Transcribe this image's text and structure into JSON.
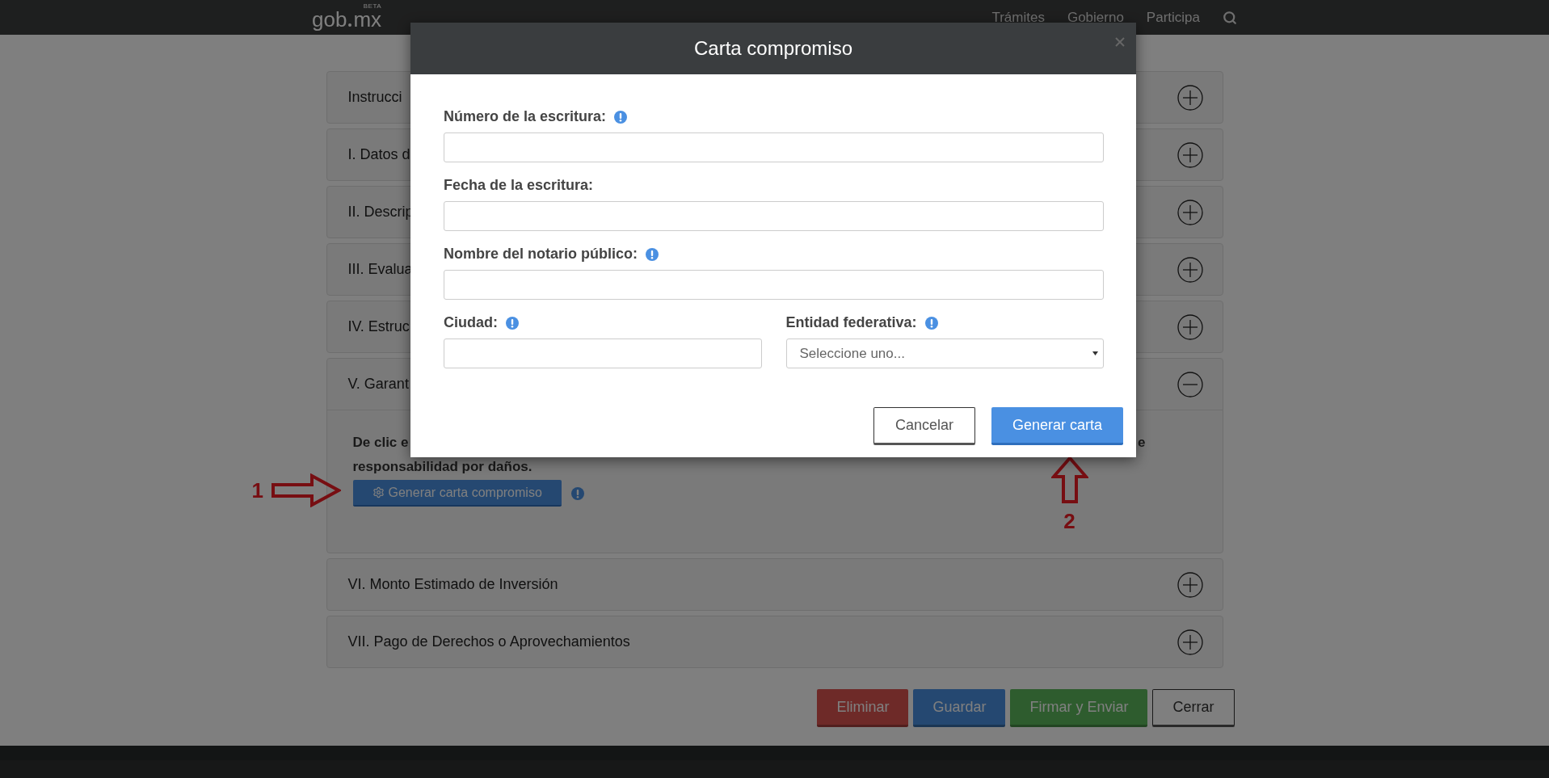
{
  "navbar": {
    "logo": {
      "text": "gob",
      "suffix": "mx",
      "badge": "BETA"
    },
    "links": [
      "Trámites",
      "Gobierno",
      "Participa"
    ]
  },
  "sections": [
    {
      "title": "Instrucci",
      "expanded": false
    },
    {
      "title": "I. Datos d",
      "expanded": false
    },
    {
      "title": "II. Descrip",
      "expanded": false
    },
    {
      "title": "III. Evalua",
      "expanded": false
    },
    {
      "title": "IV. Estruc",
      "expanded": false
    },
    {
      "title": "V. Garant",
      "expanded": true,
      "body": {
        "text_start": "De clic e",
        "text_end": "e",
        "text_line_2": "responsabilidad por daños.",
        "button": "Generar carta compromiso"
      }
    },
    {
      "title": "VI. Monto Estimado de Inversión",
      "expanded": false
    },
    {
      "title": "VII. Pago de Derechos o Aprovechamientos",
      "expanded": false
    }
  ],
  "actions": [
    {
      "label": "Eliminar",
      "kind": "danger"
    },
    {
      "label": "Guardar",
      "kind": "primary"
    },
    {
      "label": "Firmar y Enviar",
      "kind": "success"
    },
    {
      "label": "Cerrar",
      "kind": "default"
    }
  ],
  "modal": {
    "title": "Carta compromiso",
    "rows": [
      [
        {
          "label": "Número de la escritura:",
          "kind": "text",
          "info": true
        }
      ],
      [
        {
          "label": "Fecha de la escritura:",
          "kind": "text",
          "info": false
        }
      ],
      [
        {
          "label": "Nombre del notario público:",
          "kind": "text",
          "info": true
        }
      ],
      [
        {
          "label": "Ciudad:",
          "kind": "text",
          "info": true
        },
        {
          "label": "Entidad federativa:",
          "kind": "select",
          "info": true,
          "placeholder": "Seleccione uno..."
        }
      ]
    ],
    "buttons": [
      {
        "label": "Cancelar",
        "kind": "default"
      },
      {
        "label": "Generar carta",
        "kind": "primary"
      }
    ]
  },
  "annotations": [
    {
      "label": "1",
      "kind": "right"
    },
    {
      "label": "2",
      "kind": "up"
    }
  ]
}
